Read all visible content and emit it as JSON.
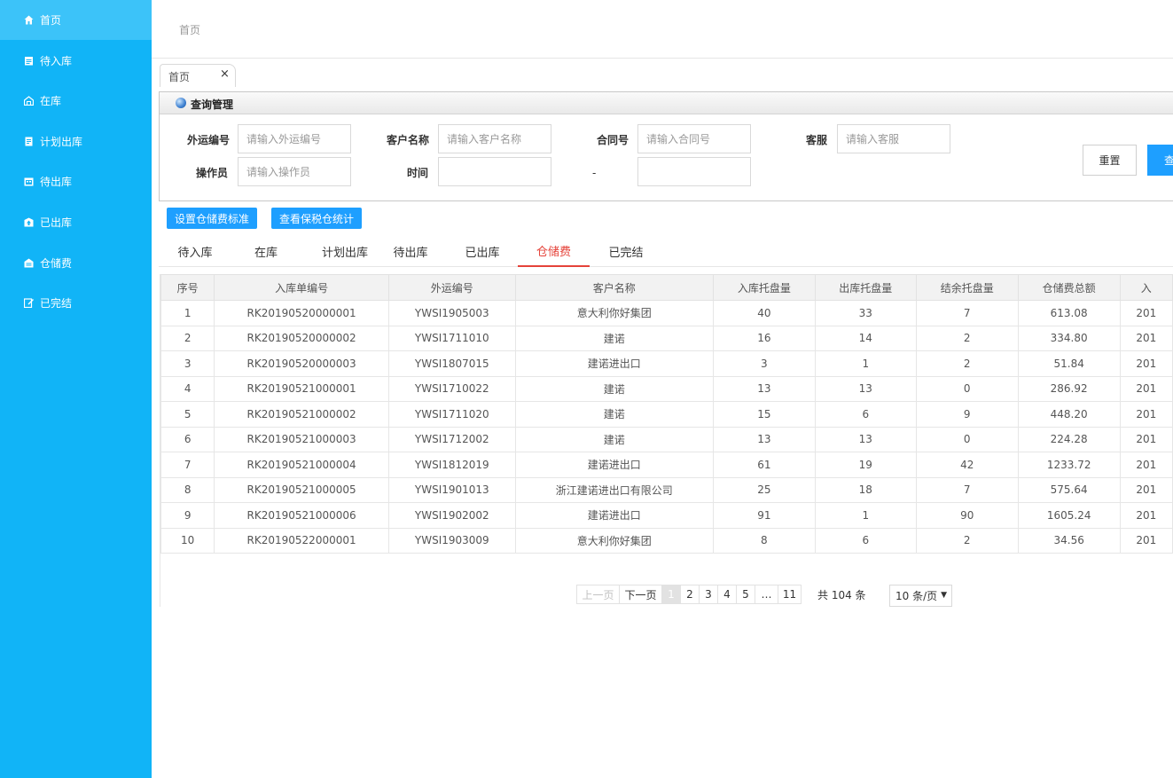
{
  "sidebar": {
    "items": [
      {
        "label": "首页",
        "icon": "home-icon"
      },
      {
        "label": "待入库",
        "icon": "clipboard-icon"
      },
      {
        "label": "在库",
        "icon": "warehouse-icon"
      },
      {
        "label": "计划出库",
        "icon": "document-icon"
      },
      {
        "label": "待出库",
        "icon": "calendar-icon"
      },
      {
        "label": "已出库",
        "icon": "upload-box-icon"
      },
      {
        "label": "仓储费",
        "icon": "storage-icon"
      },
      {
        "label": "已完结",
        "icon": "edit-check-icon"
      }
    ],
    "active_index": 0,
    "bg_color": "#11b4f7"
  },
  "breadcrumb": "首页",
  "page_tab": {
    "label": "首页",
    "close": "×"
  },
  "query": {
    "title": "查询管理",
    "fields": {
      "waybill": {
        "label": "外运编号",
        "placeholder": "请输入外运编号"
      },
      "customer": {
        "label": "客户名称",
        "placeholder": "请输入客户名称"
      },
      "contract": {
        "label": "合同号",
        "placeholder": "请输入合同号"
      },
      "service": {
        "label": "客服",
        "placeholder": "请输入客服"
      },
      "operator": {
        "label": "操作员",
        "placeholder": "请输入操作员"
      },
      "time": {
        "label": "时间",
        "placeholder": ""
      },
      "time_end": {
        "placeholder": ""
      }
    },
    "range_dash": "-",
    "reset_label": "重置",
    "query_label": "查"
  },
  "actions": {
    "set_fee_standard": "设置仓储费标准",
    "view_bonded_stats": "查看保税仓统计"
  },
  "status_tabs": [
    {
      "label": "待入库"
    },
    {
      "label": "在库"
    },
    {
      "label": "计划出库"
    },
    {
      "label": "待出库"
    },
    {
      "label": "已出库"
    },
    {
      "label": "仓储费"
    },
    {
      "label": "已完结"
    }
  ],
  "status_active_index": 5,
  "accent_color": "#e5433a",
  "table": {
    "headers": [
      "序号",
      "入库单编号",
      "外运编号",
      "客户名称",
      "入库托盘量",
      "出库托盘量",
      "结余托盘量",
      "仓储费总额",
      "入"
    ],
    "rows": [
      [
        "1",
        "RK20190520000001",
        "YWSI1905003",
        "意大利你好集团",
        "40",
        "33",
        "7",
        "613.08",
        "201"
      ],
      [
        "2",
        "RK20190520000002",
        "YWSI1711010",
        "建诺",
        "16",
        "14",
        "2",
        "334.80",
        "201"
      ],
      [
        "3",
        "RK20190520000003",
        "YWSI1807015",
        "建诺进出口",
        "3",
        "1",
        "2",
        "51.84",
        "201"
      ],
      [
        "4",
        "RK20190521000001",
        "YWSI1710022",
        "建诺",
        "13",
        "13",
        "0",
        "286.92",
        "201"
      ],
      [
        "5",
        "RK20190521000002",
        "YWSI1711020",
        "建诺",
        "15",
        "6",
        "9",
        "448.20",
        "201"
      ],
      [
        "6",
        "RK20190521000003",
        "YWSI1712002",
        "建诺",
        "13",
        "13",
        "0",
        "224.28",
        "201"
      ],
      [
        "7",
        "RK20190521000004",
        "YWSI1812019",
        "建诺进出口",
        "61",
        "19",
        "42",
        "1233.72",
        "201"
      ],
      [
        "8",
        "RK20190521000005",
        "YWSI1901013",
        "浙江建诺进出口有限公司",
        "25",
        "18",
        "7",
        "575.64",
        "201"
      ],
      [
        "9",
        "RK20190521000006",
        "YWSI1902002",
        "建诺进出口",
        "91",
        "1",
        "90",
        "1605.24",
        "201"
      ],
      [
        "10",
        "RK20190522000001",
        "YWSI1903009",
        "意大利你好集团",
        "8",
        "6",
        "2",
        "34.56",
        "201"
      ]
    ]
  },
  "pagination": {
    "prev": "上一页",
    "next": "下一页",
    "pages": [
      "1",
      "2",
      "3",
      "4",
      "5",
      "…",
      "11"
    ],
    "current": "1",
    "total": "共 104 条",
    "page_size": "10 条/页"
  }
}
